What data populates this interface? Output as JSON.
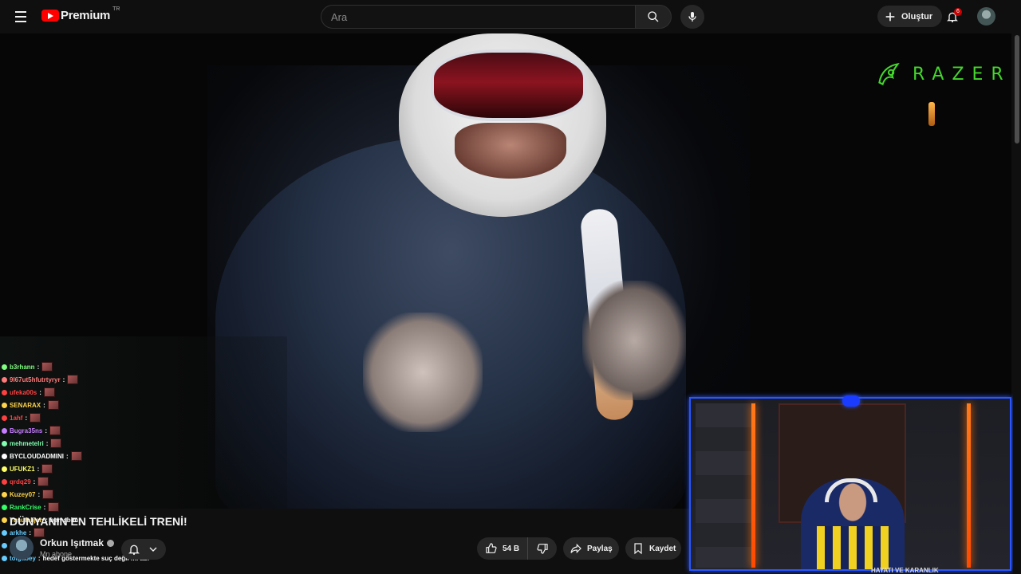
{
  "header": {
    "logo_brand": "Premium",
    "logo_region": "TR",
    "search_placeholder": "Ara",
    "create_label": "Oluştur",
    "notification_count": "6"
  },
  "video": {
    "overlay_brand": "RAZER",
    "webcam_caption": "HAYATI VE KARANLIK"
  },
  "chat": [
    {
      "user": "b3rhann",
      "color": "#7fff7f",
      "msg": ""
    },
    {
      "user": "9l67ut5hfutrtyryr",
      "color": "#ff7b7b",
      "msg": ""
    },
    {
      "user": "ufeka00s",
      "color": "#ff4040",
      "msg": ""
    },
    {
      "user": "SENARAX",
      "color": "#ffd44a",
      "msg": ""
    },
    {
      "user": "1ahf",
      "color": "#ff4040",
      "msg": ""
    },
    {
      "user": "Bugra35ns",
      "color": "#c77dff",
      "msg": ""
    },
    {
      "user": "mehmetelri",
      "color": "#7fffb0",
      "msg": ""
    },
    {
      "user": "BYCLOUDADMINI",
      "color": "#ffffff",
      "msg": ""
    },
    {
      "user": "UFUKZ1",
      "color": "#ffff66",
      "msg": ""
    },
    {
      "user": "qrdq29",
      "color": "#ff4040",
      "msg": ""
    },
    {
      "user": "Kuzey07",
      "color": "#ffd44a",
      "msg": ""
    },
    {
      "user": "RankCrise",
      "color": "#33ff66",
      "msg": ""
    },
    {
      "user": "Yusufalijan",
      "color": "#ffd44a",
      "msg": "ben abim"
    },
    {
      "user": "arkhe",
      "color": "#66ccff",
      "msg": ""
    },
    {
      "user": "",
      "color": "#66ccff",
      "msg": ""
    },
    {
      "user": "tolgabey",
      "color": "#66ccff",
      "msg": "hedef göstermekte suç değil mi abi"
    }
  ],
  "video_info": {
    "title": "DÜNYANIN EN TEHLİKELİ TRENİ!",
    "channel_name": "Orkun Işıtmak",
    "subscribers": "Mn abone",
    "likes": "54 B",
    "share_label": "Paylaş",
    "save_label": "Kaydet"
  },
  "colors": {
    "accent_red": "#ff0000",
    "razer_green": "#44d62c",
    "webcam_border": "#2a55ff"
  }
}
